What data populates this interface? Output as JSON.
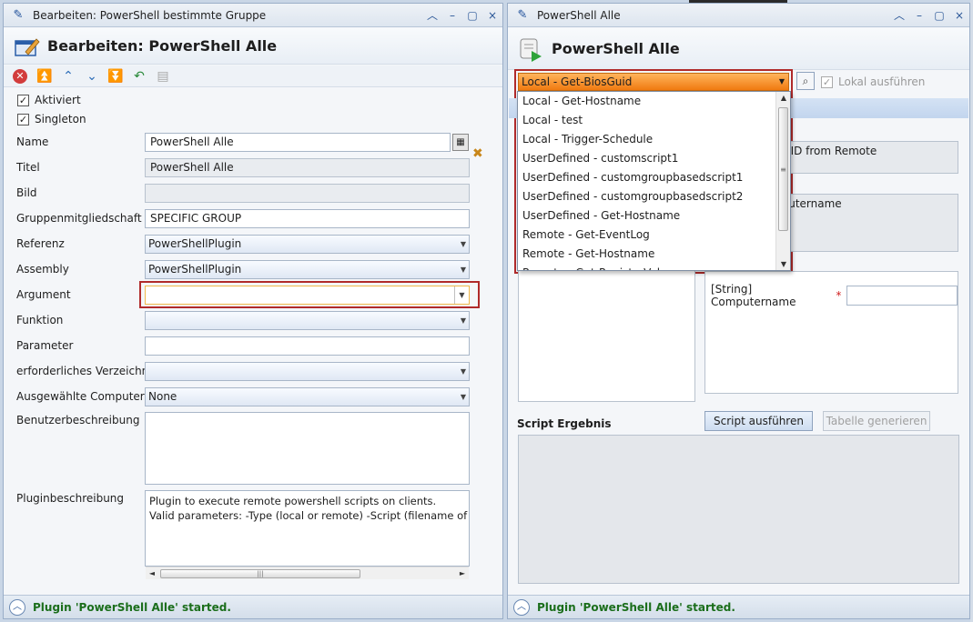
{
  "left": {
    "window_title": "Bearbeiten: PowerShell bestimmte Gruppe",
    "header_title": "Bearbeiten: PowerShell Alle",
    "checks": [
      {
        "label": "Aktiviert",
        "checked": true
      },
      {
        "label": "Singleton",
        "checked": true
      }
    ],
    "fields": {
      "name": {
        "label": "Name",
        "value": "PowerShell Alle"
      },
      "titel": {
        "label": "Titel",
        "value": "PowerShell Alle"
      },
      "bild": {
        "label": "Bild",
        "value": ""
      },
      "gruppe": {
        "label": "Gruppenmitgliedschaft",
        "value": "SPECIFIC GROUP"
      },
      "referenz": {
        "label": "Referenz",
        "value": "PowerShellPlugin"
      },
      "assembly": {
        "label": "Assembly",
        "value": "PowerShellPlugin"
      },
      "argument": {
        "label": "Argument",
        "value": ""
      },
      "funktion": {
        "label": "Funktion",
        "value": ""
      },
      "parameter": {
        "label": "Parameter",
        "value": ""
      },
      "verzeichnis": {
        "label": "erforderliches Verzeichnis",
        "value": ""
      },
      "computer": {
        "label": "Ausgewählte Computer",
        "value": "None"
      },
      "benutzerbeschreibung": {
        "label": "Benutzerbeschreibung",
        "value": ""
      },
      "pluginbeschreibung": {
        "label": "Pluginbeschreibung",
        "line1": "Plugin to execute remote powershell scripts on clients.",
        "line2": "Valid parameters: -Type (local or remote) -Script (filename of the sc"
      }
    },
    "status": "Plugin 'PowerShell Alle' started."
  },
  "right": {
    "window_title": "PowerShell Alle",
    "header_title": "PowerShell Alle",
    "script_selected": "Local - Get-BiosGuid",
    "lokal_label": "Lokal ausführen",
    "lokal_checked": true,
    "desc_title_partial": "ng",
    "desc_text_partial": "UUID from Remote",
    "param_text_partial": "uputername",
    "param_label": "[String]  Computername",
    "param_required": "*",
    "param_value": "",
    "script_result_label": "Script Ergebnis",
    "run_button": "Script ausführen",
    "table_button": "Tabelle generieren",
    "dropdown_items": [
      "Local - Get-Hostname",
      "Local - test",
      "Local - Trigger-Schedule",
      "UserDefined - customscript1",
      "UserDefined - customgroupbasedscript1",
      "UserDefined - customgroupbasedscript2",
      "UserDefined - Get-Hostname",
      "Remote - Get-EventLog",
      "Remote - Get-Hostname",
      "Remote - Get-RegistryValue"
    ],
    "status": "Plugin 'PowerShell Alle' started."
  },
  "colors": {
    "accent_orange": "#f07a10",
    "highlight_red": "#b02a2a",
    "status_green": "#1b6e1b"
  }
}
